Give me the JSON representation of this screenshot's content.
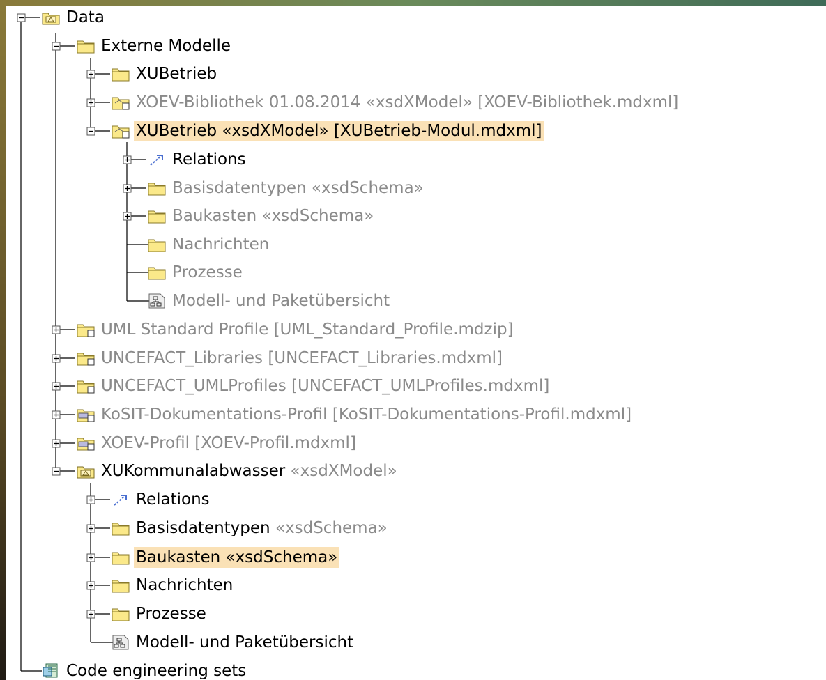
{
  "tree": {
    "data": "Data",
    "externe_modelle": "Externe Modelle",
    "xubetrieb": "XUBetrieb",
    "xoev_bibliothek": "XOEV-Bibliothek 01.08.2014 «xsdXModel» [XOEV-Bibliothek.mdxml]",
    "xubetrieb_model": "XUBetrieb «xsdXModel» [XUBetrieb-Modul.mdxml]",
    "relations_1": "Relations",
    "basisdatentypen_1": "Basisdatentypen «xsdSchema»",
    "baukasten_1": "Baukasten «xsdSchema»",
    "nachrichten_1": "Nachrichten",
    "prozesse_1": "Prozesse",
    "modell_uebersicht_1": "Modell- und Paketübersicht",
    "uml_standard": "UML Standard Profile [UML_Standard_Profile.mdzip]",
    "uncefact_libraries": "UNCEFACT_Libraries [UNCEFACT_Libraries.mdxml]",
    "uncefact_umlprofiles": "UNCEFACT_UMLProfiles [UNCEFACT_UMLProfiles.mdxml]",
    "kosit_profil": "KoSIT-Dokumentations-Profil [KoSIT-Dokumentations-Profil.mdxml]",
    "xoev_profil": "XOEV-Profil [XOEV-Profil.mdxml]",
    "xukommunal_name": "XUKommunalabwasser",
    "xukommunal_stereo": "«xsdXModel»",
    "relations_2": "Relations",
    "basisdatentypen_2_name": "Basisdatentypen",
    "basisdatentypen_2_stereo": "«xsdSchema»",
    "baukasten_2": "Baukasten «xsdSchema»",
    "nachrichten_2": "Nachrichten",
    "prozesse_2": "Prozesse",
    "modell_uebersicht_2": "Modell- und Paketübersicht",
    "code_engineering": "Code engineering sets"
  },
  "colors": {
    "selection": "#fae1b6",
    "folder": "#fbe98a",
    "dim_text": "#8a8a8a"
  }
}
